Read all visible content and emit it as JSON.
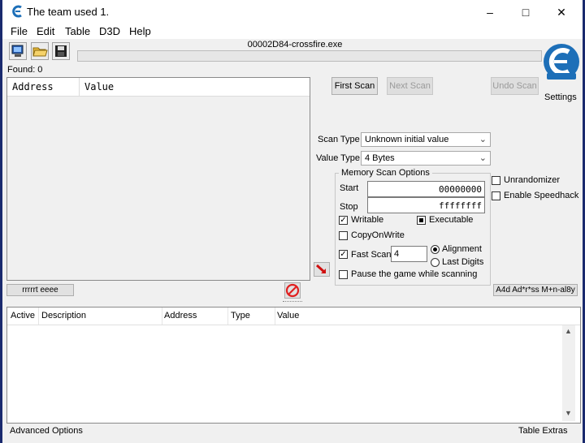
{
  "window": {
    "title": "The team used 1.",
    "min_icon": "minimize-icon",
    "max_icon": "maximize-icon",
    "close_icon": "close-icon"
  },
  "menu": [
    "File",
    "Edit",
    "Table",
    "D3D",
    "Help"
  ],
  "toolbar": {
    "process_name": "00002D84-crossfire.exe",
    "settings_label": "Settings"
  },
  "found_label": "Found: 0",
  "results_headers": {
    "address": "Address",
    "value": "Value"
  },
  "scan_buttons": {
    "first": "First Scan",
    "next": "Next Scan",
    "undo": "Undo Scan"
  },
  "scan_type": {
    "label": "Scan Type",
    "value": "Unknown initial value"
  },
  "value_type": {
    "label": "Value Type",
    "value": "4 Bytes"
  },
  "memory_options": {
    "title": "Memory Scan Options",
    "start_label": "Start",
    "start_value": "00000000",
    "stop_label": "Stop",
    "stop_value": "ffffffff",
    "writable": "Writable",
    "executable": "Executable",
    "copyonwrite": "CopyOnWrite",
    "fast_scan": "Fast Scan",
    "fast_scan_value": "4",
    "alignment": "Alignment",
    "last_digits": "Last Digits",
    "pause": "Pause the game while scanning"
  },
  "extras": {
    "unrandomizer": "Unrandomizer",
    "speedhack": "Enable Speedhack"
  },
  "memory_view_button": "rrrrrt eeee",
  "add_address_button": "A4d Ad*r*ss M+n-al8y",
  "table_headers": {
    "active": "Active",
    "description": "Description",
    "address": "Address",
    "type": "Type",
    "value": "Value"
  },
  "footer": {
    "advanced": "Advanced Options",
    "extras": "Table Extras"
  },
  "colors": {
    "accent": "#0078d7",
    "logo_blue": "#1d6fb8",
    "stop_red": "#e02020"
  }
}
